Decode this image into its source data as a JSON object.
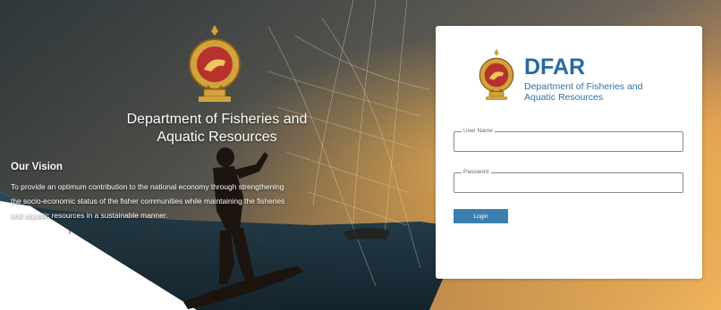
{
  "hero": {
    "department_title_line1": "Department of Fisheries and",
    "department_title_line2": "Aquatic Resources",
    "vision_heading": "Our Vision",
    "vision_text_line1": "To provide an optimum contribution to the national economy through strengthening",
    "vision_text_line2": "the socio-economic status of the fisher communities while maintaining the fisheries",
    "vision_text_line3": "and aquatic resources in a sustainable manner."
  },
  "login": {
    "brand_name": "DFAR",
    "brand_subtitle_line1": "Department of Fisheries and",
    "brand_subtitle_line2": "Aquatic Resources",
    "username_label": "User Name",
    "username_value": "",
    "password_label": "Password",
    "password_value": "",
    "login_button_label": "Login"
  },
  "colors": {
    "brand_blue": "#27699f",
    "button_blue": "#3b7fb1",
    "crest_gold": "#d2a23d",
    "crest_red": "#b8322d"
  },
  "icons": {
    "hero_crest": "sri-lanka-emblem-icon",
    "card_crest": "sri-lanka-emblem-icon"
  }
}
